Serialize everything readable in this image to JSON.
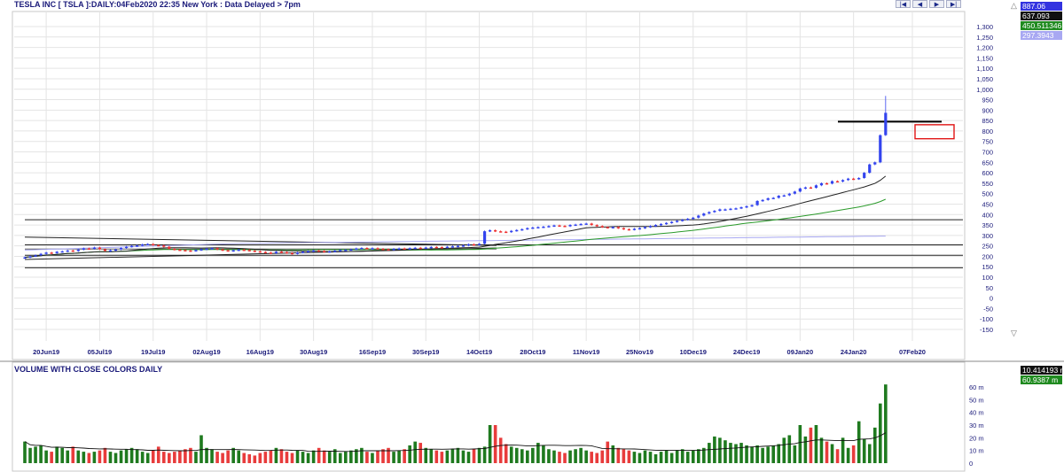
{
  "header": {
    "title": "TESLA INC [ TSLA ]:DAILY:04Feb2020 22:35 New York : Data Delayed > 7pm"
  },
  "nav_buttons": [
    {
      "name": "first-button",
      "glyph": "|◀"
    },
    {
      "name": "prev-button",
      "glyph": "◀"
    },
    {
      "name": "next-button",
      "glyph": "▶"
    },
    {
      "name": "last-button",
      "glyph": "▶|"
    }
  ],
  "price_badges": [
    {
      "label": "887.06",
      "color": "#3333e0"
    },
    {
      "label": "637.093",
      "color": "#111111"
    },
    {
      "label": "450.511346",
      "color": "#1f8a1f"
    },
    {
      "label": "297.3943",
      "color": "#a8a8f2"
    }
  ],
  "volume_badges": [
    {
      "label": "10.414193 m",
      "color": "#111111"
    },
    {
      "label": "60.9387 m",
      "color": "#1f8a1f"
    }
  ],
  "volume_panel": {
    "title": "VOLUME WITH CLOSE COLORS DAILY"
  },
  "colors": {
    "up": "#3344ee",
    "down": "#ee3333",
    "ma_fast": "#222222",
    "ma_mid": "#2a9a2a",
    "ma_slow": "#a8a8f2",
    "vol_up": "#1f7a1f",
    "vol_down": "#e83c3c",
    "grid": "#e4e4e4",
    "hline": "#222222",
    "box": "#e01515"
  },
  "chart_data": [
    {
      "type": "candlestick",
      "title": "TESLA INC [ TSLA ]:DAILY:04Feb2020 22:35 New York : Data Delayed > 7pm",
      "ylim": [
        -175,
        1350
      ],
      "y_ticks": [
        1300,
        1250,
        1200,
        1150,
        1100,
        1050,
        1000,
        950,
        900,
        850,
        800,
        750,
        700,
        650,
        600,
        550,
        500,
        450,
        400,
        350,
        300,
        250,
        200,
        150,
        100,
        50,
        0,
        -50,
        -100,
        -150
      ],
      "x_tick_labels": [
        "20Jun19",
        "05Jul19",
        "19Jul19",
        "02Aug19",
        "16Aug19",
        "30Aug19",
        "16Sep19",
        "30Sep19",
        "14Oct19",
        "28Oct19",
        "11Nov19",
        "25Nov19",
        "10Dec19",
        "24Dec19",
        "09Jan20",
        "24Jan20",
        "07Feb20"
      ],
      "x_tick_index": [
        4,
        14,
        24,
        34,
        44,
        54,
        65,
        75,
        85,
        95,
        105,
        115,
        125,
        135,
        145,
        155,
        166
      ],
      "grid": true,
      "series_close": [
        195,
        200,
        205,
        212,
        218,
        215,
        222,
        224,
        228,
        225,
        232,
        238,
        236,
        242,
        234,
        226,
        229,
        233,
        240,
        246,
        250,
        252,
        257,
        259,
        254,
        252,
        246,
        236,
        232,
        230,
        228,
        226,
        230,
        234,
        237,
        239,
        233,
        229,
        226,
        229,
        232,
        230,
        227,
        224,
        221,
        218,
        215,
        222,
        220,
        216,
        213,
        218,
        222,
        225,
        228,
        226,
        221,
        224,
        227,
        230,
        231,
        233,
        238,
        240,
        236,
        239,
        236,
        234,
        232,
        236,
        238,
        236,
        239,
        241,
        240,
        242,
        245,
        244,
        243,
        246,
        248,
        250,
        252,
        258,
        255,
        260,
        320,
        325,
        320,
        318,
        316,
        322,
        326,
        330,
        335,
        338,
        340,
        342,
        345,
        348,
        346,
        344,
        350,
        352,
        355,
        357,
        350,
        345,
        340,
        338,
        340,
        335,
        330,
        328,
        332,
        335,
        340,
        345,
        350,
        355,
        360,
        365,
        370,
        375,
        380,
        385,
        395,
        405,
        412,
        418,
        425,
        425,
        428,
        430,
        435,
        440,
        445,
        465,
        470,
        478,
        480,
        490,
        492,
        500,
        510,
        525,
        530,
        528,
        540,
        550,
        548,
        560,
        558,
        565,
        572,
        570,
        575,
        600,
        640,
        650,
        780,
        887
      ],
      "ma_fast_approx": "20-day moving average, ending 637.093",
      "ma_mid_approx": "50-day moving average, ending 450.511346",
      "ma_slow_approx": "200-day moving average, ending 297.3943",
      "horizontal_lines": [
        375,
        255,
        205,
        145
      ],
      "short_hline": 845,
      "box_range": [
        763,
        830
      ],
      "last_high": 968
    },
    {
      "type": "bar",
      "title": "VOLUME WITH CLOSE COLORS DAILY",
      "y_ticks_label": [
        "60 m",
        "50 m",
        "40 m",
        "30 m",
        "20 m",
        "10 m",
        "0"
      ],
      "y_ticks_value": [
        60,
        50,
        40,
        30,
        20,
        10,
        0
      ],
      "ylim": [
        0,
        65
      ],
      "unit": "m",
      "values": [
        17,
        12,
        13,
        14,
        10,
        9,
        13,
        12,
        10,
        13,
        10,
        9,
        8,
        9,
        10,
        12,
        9,
        8,
        10,
        11,
        12,
        11,
        9,
        8,
        10,
        13,
        9,
        8,
        9,
        10,
        11,
        12,
        9,
        22,
        12,
        11,
        9,
        8,
        10,
        12,
        10,
        8,
        7,
        6,
        8,
        9,
        10,
        12,
        11,
        9,
        8,
        10,
        9,
        8,
        10,
        12,
        10,
        9,
        11,
        8,
        9,
        10,
        11,
        12,
        9,
        8,
        10,
        11,
        12,
        9,
        10,
        11,
        14,
        17,
        16,
        12,
        11,
        10,
        9,
        10,
        11,
        12,
        10,
        9,
        11,
        12,
        13,
        30,
        30,
        20,
        15,
        13,
        12,
        11,
        10,
        12,
        16,
        14,
        11,
        10,
        9,
        8,
        10,
        11,
        12,
        10,
        9,
        8,
        10,
        17,
        14,
        12,
        11,
        10,
        9,
        8,
        10,
        9,
        7,
        9,
        10,
        8,
        10,
        11,
        9,
        10,
        11,
        12,
        16,
        21,
        20,
        18,
        16,
        15,
        16,
        14,
        13,
        14,
        12,
        13,
        14,
        15,
        20,
        22,
        14,
        30,
        21,
        28,
        30,
        20,
        17,
        15,
        11,
        20,
        12,
        14,
        33,
        19,
        15,
        28,
        47,
        62
      ],
      "close_colors": "up=green, down=red",
      "moving_average": 10.414193,
      "last_value": 60.9387
    }
  ]
}
